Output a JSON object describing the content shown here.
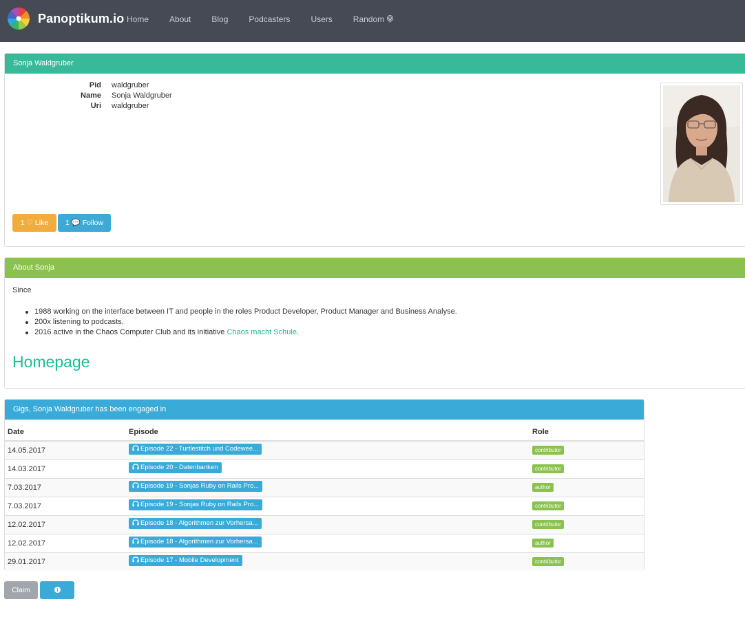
{
  "brand": {
    "name": "Panoptikum.io"
  },
  "nav": {
    "items": [
      "Home",
      "About",
      "Blog",
      "Podcasters",
      "Users",
      "Random"
    ],
    "random_icon": "podcast-icon"
  },
  "profile": {
    "heading": "Sonja Waldgruber",
    "fields": [
      {
        "label": "Pid",
        "value": "waldgruber"
      },
      {
        "label": "Name",
        "value": "Sonja Waldgruber"
      },
      {
        "label": "Uri",
        "value": "waldgruber"
      }
    ],
    "like_label": "1 ♡ Like",
    "follow_label": "1 💬 Follow"
  },
  "about": {
    "heading": "About Sonja",
    "since": "Since",
    "bullets": [
      "1988 working on the interface between IT and people in the roles Product Developer, Product Manager and Business Analyse.",
      "200x listening to podcasts."
    ],
    "bullet3_prefix": "2016 active in the Chaos Computer Club and its initiative ",
    "bullet3_link": "Chaos macht Schule",
    "bullet3_suffix": ".",
    "homepage": "Homepage"
  },
  "gigs": {
    "heading": "Gigs, Sonja Waldgruber has been engaged in",
    "columns": [
      "Date",
      "Episode",
      "Role"
    ],
    "rows": [
      {
        "date": "14.05.2017",
        "episode": "Episode 22 - Turtlestitch und Codewee...",
        "role": "contributor"
      },
      {
        "date": "14.03.2017",
        "episode": "Episode 20 - Datenbanken",
        "role": "contributor"
      },
      {
        "date": "7.03.2017",
        "episode": "Episode 19 - Sonjas Ruby on Rails Pro...",
        "role": "author"
      },
      {
        "date": "7.03.2017",
        "episode": "Episode 19 - Sonjas Ruby on Rails Pro...",
        "role": "contributor"
      },
      {
        "date": "12.02.2017",
        "episode": "Episode 18 - Algorithmen zur Vorhersa...",
        "role": "contributor"
      },
      {
        "date": "12.02.2017",
        "episode": "Episode 18 - Algorithmen zur Vorhersa...",
        "role": "author"
      },
      {
        "date": "29.01.2017",
        "episode": "Episode 17 - Mobile Development",
        "role": "contributor"
      }
    ]
  },
  "actions": {
    "claim": "Claim",
    "help": "Help"
  },
  "colors": {
    "navbar": "#454a54",
    "profile_heading": "#37b99a",
    "about_heading": "#8bc14f",
    "gigs_heading": "#3aaad9",
    "like_button": "#f0ad3e",
    "follow_button": "#3fa9d6"
  }
}
